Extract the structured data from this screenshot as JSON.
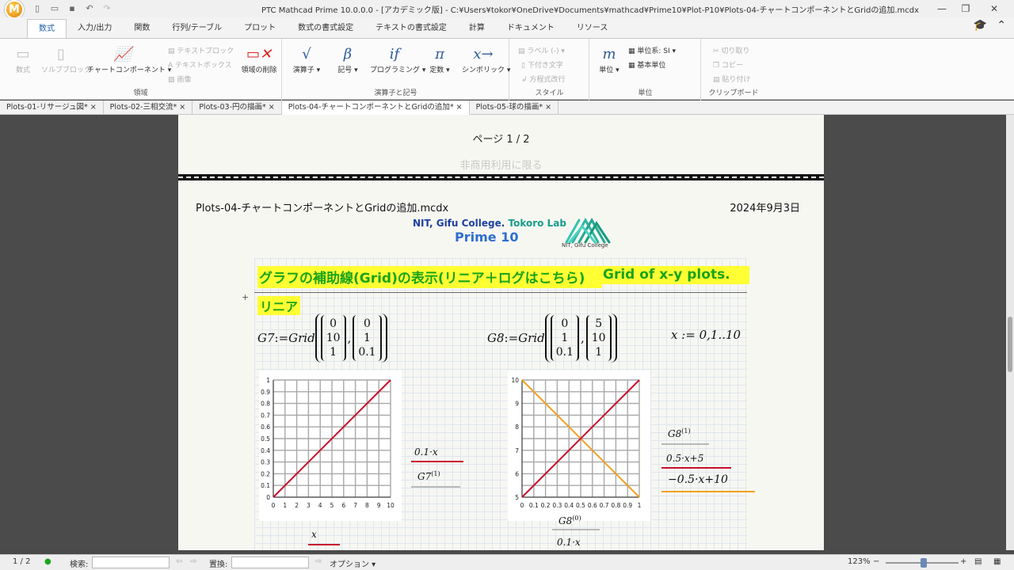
{
  "window": {
    "title": "PTC Mathcad Prime 10.0.0.0 - [アカデミック版] - C:¥Users¥tokor¥OneDrive¥Documents¥mathcad¥Prime10¥Plot-P10¥Plots-04-チャートコンポーネントとGridの追加.mcdx",
    "logo_letter": "M"
  },
  "ribbon_tabs": [
    "数式",
    "入力/出力",
    "関数",
    "行列/テーブル",
    "プロット",
    "数式の書式設定",
    "テキストの書式設定",
    "計算",
    "ドキュメント",
    "リソース"
  ],
  "ribbon": {
    "region_group": {
      "math": "数式",
      "solve_block": "ソルブブロック",
      "chart_component": "チャートコンポーネント",
      "text_block": "テキストブロック",
      "text_box": "テキストボックス",
      "image": "画像",
      "delete_region": "領域の削除",
      "label": "領域"
    },
    "operators_group": {
      "operators": "演算子",
      "symbols": "記号",
      "programming": "プログラミング",
      "constants": "定数",
      "symbolic": "シンボリック",
      "label": "演算子と記号",
      "glyph_operators": "√",
      "glyph_symbols": "β",
      "glyph_programming": "if",
      "glyph_constants": "π",
      "glyph_symbolic": "x→"
    },
    "style_group": {
      "label_dropdown": "ラベル  (-)",
      "subscript": "下付き文字",
      "eq_line_break": "方程式改行",
      "label": "スタイル"
    },
    "units_group": {
      "units": "単位",
      "unit_system": "単位系: SI",
      "base_units": "基本単位",
      "label": "単位",
      "glyph_units": "m"
    },
    "clipboard_group": {
      "cut": "切り取り",
      "copy": "コピー",
      "paste": "貼り付け",
      "label": "クリップボード"
    }
  },
  "doc_tabs": [
    {
      "label": "Plots-01-リサージュ図*",
      "active": false
    },
    {
      "label": "Plots-02-三相交流*",
      "active": false
    },
    {
      "label": "Plots-03-円の描画*",
      "active": false
    },
    {
      "label": "Plots-04-チャートコンポーネントとGridの追加*",
      "active": true
    },
    {
      "label": "Plots-05-球の描画*",
      "active": false
    }
  ],
  "close_glyph": "×",
  "page1": {
    "page_number": "ページ 1 / 2",
    "watermark": "非商用利用に限る"
  },
  "page2": {
    "filename": "Plots-04-チャートコンポーネントとGridの追加.mcdx",
    "date": "2024年9月3日",
    "lab_a": "NIT, Gifu College.",
    "lab_b": "Tokoro Lab",
    "prime": "Prime 10",
    "logo_caption": "NIT, Gifu College",
    "heading_ja": "グラフの補助線(Grid)の表示(リニア＋ログはこちら)",
    "heading_en": "Grid of x-y plots.",
    "section_linear": "リニア",
    "expand_glyph": "+",
    "g7_lhs": "G7",
    "assign": ":=",
    "grid_fn": "Grid",
    "g7_m1": [
      "0",
      "10",
      "1"
    ],
    "g7_m2": [
      "0",
      "1",
      "0.1"
    ],
    "g8_lhs": "G8",
    "g8_m1": [
      "0",
      "1",
      "0.1"
    ],
    "g8_m2": [
      "5",
      "10",
      "1"
    ],
    "x_def": "x := 0,1..10",
    "comma": ","
  },
  "plot1": {
    "x_ticks": [
      "0",
      "1",
      "2",
      "3",
      "4",
      "5",
      "6",
      "7",
      "8",
      "9",
      "10"
    ],
    "y_ticks": [
      "0",
      "0.1",
      "0.2",
      "0.3",
      "0.4",
      "0.5",
      "0.6",
      "0.7",
      "0.8",
      "0.9",
      "1"
    ],
    "xlim": [
      0,
      10
    ],
    "ylim": [
      0,
      1
    ],
    "line_color": "#c8102e",
    "legend_y1": "0.1·x",
    "legend_y2": "G7",
    "legend_y2_sup": "(1)",
    "legend_x": "x"
  },
  "plot2": {
    "x_ticks": [
      "0",
      "0.1",
      "0.2",
      "0.3",
      "0.4",
      "0.5",
      "0.6",
      "0.7",
      "0.8",
      "0.9",
      "1"
    ],
    "y_ticks": [
      "5",
      "6",
      "7",
      "8",
      "9",
      "10"
    ],
    "xlim": [
      0,
      1
    ],
    "ylim": [
      5,
      10
    ],
    "red_color": "#c8102e",
    "orange_color": "#f2a01e",
    "legend_y1": "G8",
    "legend_y1_sup": "(1)",
    "legend_y2": "0.5·x+5",
    "legend_y3": "−0.5·x+10",
    "legend_x": "G8",
    "legend_x_sup": "(0)",
    "legend_x2": "0.1·x"
  },
  "status": {
    "page": "1 / 2",
    "search_label": "検索:",
    "replace_label": "置換:",
    "options": "オプション",
    "zoom": "123%"
  }
}
